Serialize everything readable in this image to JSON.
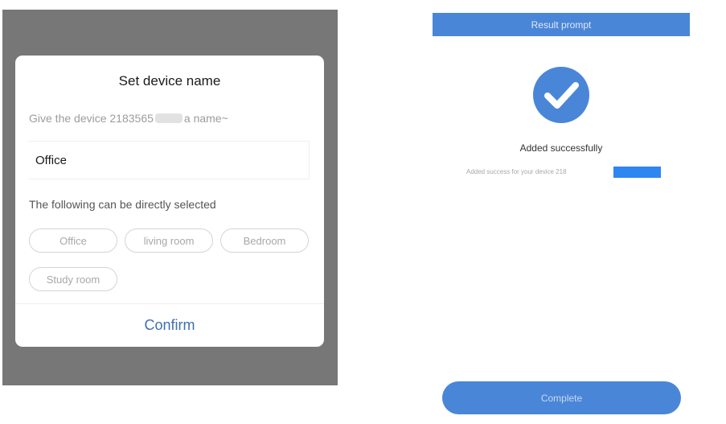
{
  "dialog": {
    "title": "Set device name",
    "prompt_prefix": "Give the device 2183565",
    "prompt_suffix": "a name~",
    "name_value": "Office",
    "select_label": "The following can be directly selected",
    "chips": [
      "Office",
      "living room",
      "Bedroom",
      "Study room"
    ],
    "confirm_label": "Confirm"
  },
  "result": {
    "header_title": "Result prompt",
    "success_title": "Added successfully",
    "success_detail": "Added success for your device 218",
    "complete_label": "Complete",
    "check_icon": "checkmark-circle-icon"
  },
  "colors": {
    "accent_blue": "#4a86d8",
    "overlay_gray": "#777777",
    "confirm_text": "#3f6fae",
    "redaction_blue": "#2e86f0"
  }
}
